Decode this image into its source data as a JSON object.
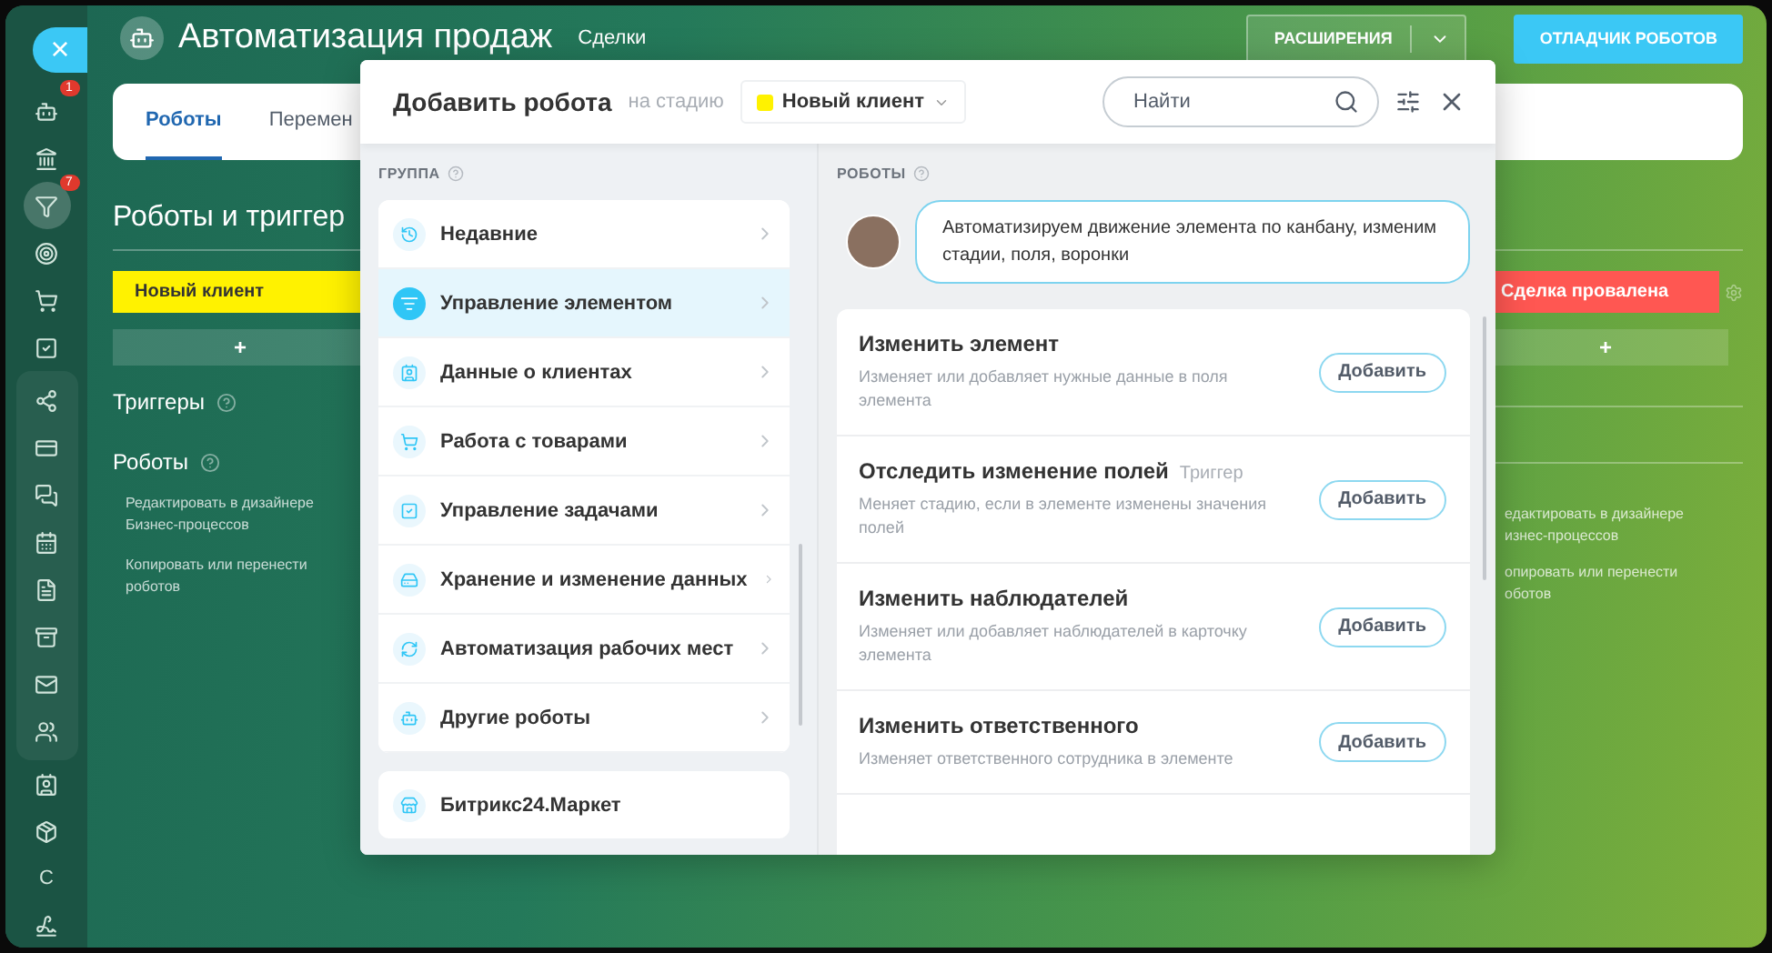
{
  "sidebar": {
    "close": "×",
    "items": [
      {
        "badge": "1",
        "selected": false
      },
      {
        "selected": false
      },
      {
        "badge": "7",
        "selected": true
      },
      {
        "selected": false
      },
      {
        "selected": false
      },
      {
        "selected": false
      },
      {
        "selected": false
      },
      {
        "selected": false
      },
      {
        "selected": false
      },
      {
        "selected": false
      },
      {
        "selected": false
      },
      {
        "selected": false
      },
      {
        "selected": false
      },
      {
        "selected": false
      },
      {
        "selected": false
      },
      {
        "selected": false
      },
      {
        "letter": "С",
        "selected": false
      },
      {
        "selected": false
      }
    ]
  },
  "header": {
    "title": "Автоматизация продаж",
    "subtitle": "Сделки",
    "extensions": "РАСШИРЕНИЯ",
    "debugger": "ОТЛАДЧИК РОБОТОВ"
  },
  "tabs": [
    {
      "label": "Роботы",
      "selected": true
    },
    {
      "label": "Перемен",
      "selected": false
    }
  ],
  "heading": "Роботы и триггер",
  "left_column": {
    "stage": "Новый клиент",
    "add": "+",
    "triggers": "Триггеры",
    "robots": "Роботы",
    "links": [
      "Редактировать в дизайнере Бизнес-процессов",
      "Копировать или перенести роботов"
    ]
  },
  "right_column": {
    "stage": "Сделка провалена",
    "add": "+",
    "links": [
      [
        "едактировать в дизайнере",
        "изнес-процессов"
      ],
      [
        "опировать или перенести",
        "оботов"
      ]
    ]
  },
  "dialog": {
    "title": "Добавить робота",
    "stage_label": "на стадию",
    "stage": "Новый клиент",
    "search": {
      "placeholder": "Найти"
    },
    "group_label": "ГРУППА",
    "groups": [
      {
        "label": "Недавние",
        "selected": false
      },
      {
        "label": "Управление элементом",
        "selected": true
      },
      {
        "label": "Данные о клиентах",
        "selected": false
      },
      {
        "label": "Работа с товарами",
        "selected": false
      },
      {
        "label": "Управление задачами",
        "selected": false
      },
      {
        "label": "Хранение и изменение данных",
        "selected": false
      },
      {
        "label": "Автоматизация рабочих мест",
        "selected": false
      },
      {
        "label": "Другие роботы",
        "selected": false
      }
    ],
    "market": "Битрикс24.Маркет",
    "robots_label": "РОБОТЫ",
    "hint": "Автоматизируем движение элемента по канбану, изменим стадии, поля, воронки",
    "robots": [
      {
        "title": "Изменить элемент",
        "description": "Изменяет или добавляет нужные данные в поля элемента",
        "button": "Добавить"
      },
      {
        "title": "Отследить изменение полей",
        "tag": "Триггер",
        "description": "Меняет стадию, если в элементе изменены значения полей",
        "button": "Добавить"
      },
      {
        "title": "Изменить наблюдателей",
        "description": "Изменяет или добавляет наблюдателей в карточку элемента",
        "button": "Добавить"
      },
      {
        "title": "Изменить ответственного",
        "description": "Изменяет ответственного сотрудника в элементе",
        "button": "Добавить"
      }
    ]
  }
}
